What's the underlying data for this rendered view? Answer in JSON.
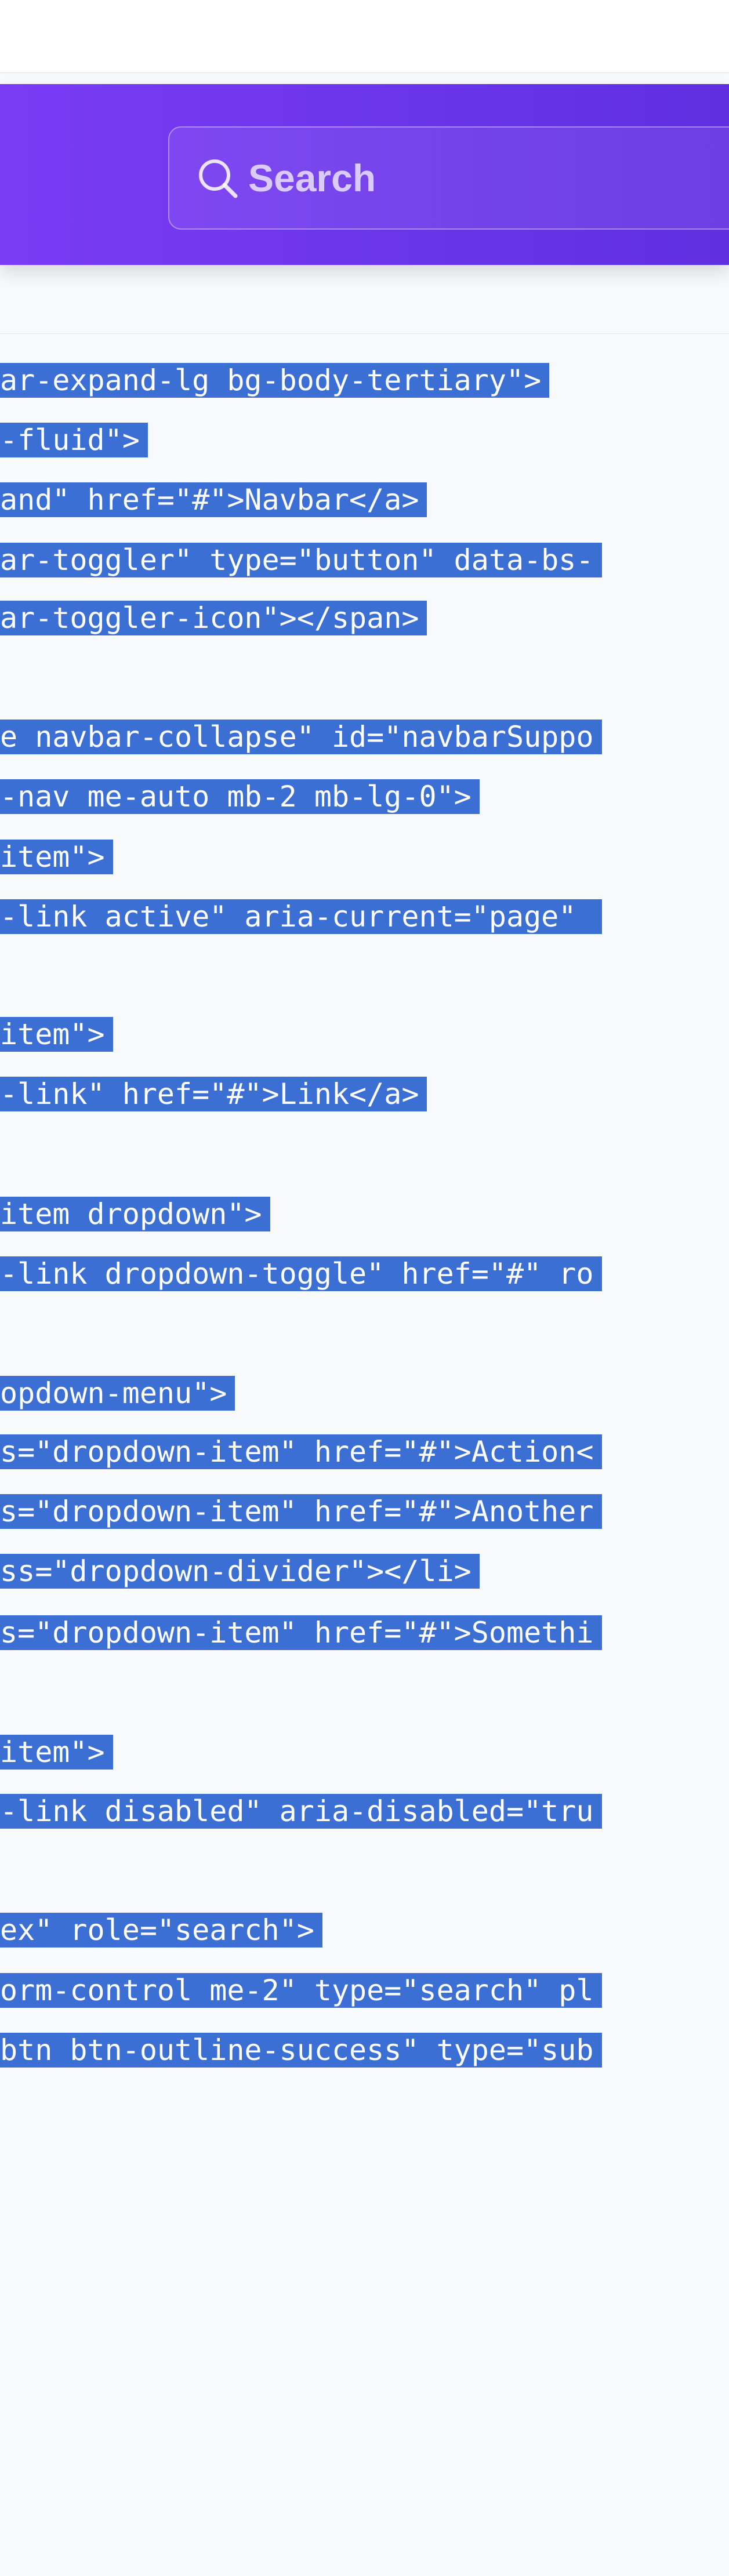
{
  "search": {
    "placeholder": "Search"
  },
  "code_lines": [
    "ar-expand-lg bg-body-tertiary\">",
    "-fluid\">",
    "and\" href=\"#\">Navbar</a>",
    "ar-toggler\" type=\"button\" data-bs-",
    "ar-toggler-icon\"></span>",
    "",
    "e navbar-collapse\" id=\"navbarSuppo",
    "-nav me-auto mb-2 mb-lg-0\">",
    "item\">",
    "-link active\" aria-current=\"page\" ",
    "",
    "item\">",
    "-link\" href=\"#\">Link</a>",
    "",
    "item dropdown\">",
    "-link dropdown-toggle\" href=\"#\" ro",
    "",
    "",
    "opdown-menu\">",
    "s=\"dropdown-item\" href=\"#\">Action<",
    "s=\"dropdown-item\" href=\"#\">Another",
    "ss=\"dropdown-divider\"></li>",
    "s=\"dropdown-item\" href=\"#\">Somethi",
    "",
    "",
    "item\">",
    "-link disabled\" aria-disabled=\"tru",
    "",
    "",
    "ex\" role=\"search\">",
    "orm-control me-2\" type=\"search\" pl",
    "btn btn-outline-success\" type=\"sub"
  ]
}
